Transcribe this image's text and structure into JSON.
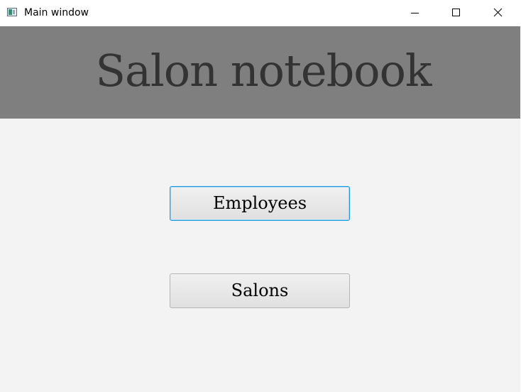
{
  "window": {
    "title": "Main window",
    "controls": {
      "minimize_icon": "minimize-icon",
      "maximize_icon": "maximize-icon",
      "close_icon": "close-icon"
    }
  },
  "header": {
    "title": "Salon notebook",
    "background": "#7f7f7f",
    "text_color": "#333333"
  },
  "buttons": {
    "employees": "Employees",
    "salons": "Salons",
    "focus_color": "#1a9be0"
  }
}
